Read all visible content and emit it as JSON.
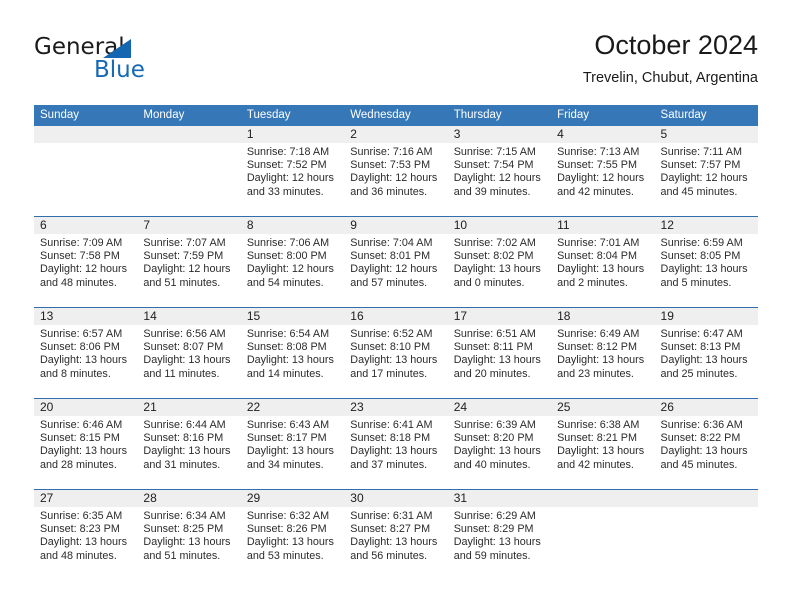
{
  "brand": {
    "name_top": "General",
    "name_bottom": "Blue",
    "triangle_color": "#1566b0",
    "text_color_top": "#1b1b1b",
    "text_color_bottom": "#1669b3"
  },
  "header": {
    "month_title": "October 2024",
    "location": "Trevelin, Chubut, Argentina"
  },
  "theme": {
    "header_bar_color": "#3577b7",
    "header_text_color": "#ffffff",
    "row_divider_color": "#2f6fad",
    "daynum_band_color": "#efefef",
    "body_text_color": "#2b2b2b"
  },
  "calendar": {
    "weekdays": [
      "Sunday",
      "Monday",
      "Tuesday",
      "Wednesday",
      "Thursday",
      "Friday",
      "Saturday"
    ],
    "weeks": [
      [
        {
          "day": "",
          "lines": [
            "",
            "",
            "",
            ""
          ]
        },
        {
          "day": "",
          "lines": [
            "",
            "",
            "",
            ""
          ]
        },
        {
          "day": "1",
          "lines": [
            "Sunrise: 7:18 AM",
            "Sunset: 7:52 PM",
            "Daylight: 12 hours",
            "and 33 minutes."
          ]
        },
        {
          "day": "2",
          "lines": [
            "Sunrise: 7:16 AM",
            "Sunset: 7:53 PM",
            "Daylight: 12 hours",
            "and 36 minutes."
          ]
        },
        {
          "day": "3",
          "lines": [
            "Sunrise: 7:15 AM",
            "Sunset: 7:54 PM",
            "Daylight: 12 hours",
            "and 39 minutes."
          ]
        },
        {
          "day": "4",
          "lines": [
            "Sunrise: 7:13 AM",
            "Sunset: 7:55 PM",
            "Daylight: 12 hours",
            "and 42 minutes."
          ]
        },
        {
          "day": "5",
          "lines": [
            "Sunrise: 7:11 AM",
            "Sunset: 7:57 PM",
            "Daylight: 12 hours",
            "and 45 minutes."
          ]
        }
      ],
      [
        {
          "day": "6",
          "lines": [
            "Sunrise: 7:09 AM",
            "Sunset: 7:58 PM",
            "Daylight: 12 hours",
            "and 48 minutes."
          ]
        },
        {
          "day": "7",
          "lines": [
            "Sunrise: 7:07 AM",
            "Sunset: 7:59 PM",
            "Daylight: 12 hours",
            "and 51 minutes."
          ]
        },
        {
          "day": "8",
          "lines": [
            "Sunrise: 7:06 AM",
            "Sunset: 8:00 PM",
            "Daylight: 12 hours",
            "and 54 minutes."
          ]
        },
        {
          "day": "9",
          "lines": [
            "Sunrise: 7:04 AM",
            "Sunset: 8:01 PM",
            "Daylight: 12 hours",
            "and 57 minutes."
          ]
        },
        {
          "day": "10",
          "lines": [
            "Sunrise: 7:02 AM",
            "Sunset: 8:02 PM",
            "Daylight: 13 hours",
            "and 0 minutes."
          ]
        },
        {
          "day": "11",
          "lines": [
            "Sunrise: 7:01 AM",
            "Sunset: 8:04 PM",
            "Daylight: 13 hours",
            "and 2 minutes."
          ]
        },
        {
          "day": "12",
          "lines": [
            "Sunrise: 6:59 AM",
            "Sunset: 8:05 PM",
            "Daylight: 13 hours",
            "and 5 minutes."
          ]
        }
      ],
      [
        {
          "day": "13",
          "lines": [
            "Sunrise: 6:57 AM",
            "Sunset: 8:06 PM",
            "Daylight: 13 hours",
            "and 8 minutes."
          ]
        },
        {
          "day": "14",
          "lines": [
            "Sunrise: 6:56 AM",
            "Sunset: 8:07 PM",
            "Daylight: 13 hours",
            "and 11 minutes."
          ]
        },
        {
          "day": "15",
          "lines": [
            "Sunrise: 6:54 AM",
            "Sunset: 8:08 PM",
            "Daylight: 13 hours",
            "and 14 minutes."
          ]
        },
        {
          "day": "16",
          "lines": [
            "Sunrise: 6:52 AM",
            "Sunset: 8:10 PM",
            "Daylight: 13 hours",
            "and 17 minutes."
          ]
        },
        {
          "day": "17",
          "lines": [
            "Sunrise: 6:51 AM",
            "Sunset: 8:11 PM",
            "Daylight: 13 hours",
            "and 20 minutes."
          ]
        },
        {
          "day": "18",
          "lines": [
            "Sunrise: 6:49 AM",
            "Sunset: 8:12 PM",
            "Daylight: 13 hours",
            "and 23 minutes."
          ]
        },
        {
          "day": "19",
          "lines": [
            "Sunrise: 6:47 AM",
            "Sunset: 8:13 PM",
            "Daylight: 13 hours",
            "and 25 minutes."
          ]
        }
      ],
      [
        {
          "day": "20",
          "lines": [
            "Sunrise: 6:46 AM",
            "Sunset: 8:15 PM",
            "Daylight: 13 hours",
            "and 28 minutes."
          ]
        },
        {
          "day": "21",
          "lines": [
            "Sunrise: 6:44 AM",
            "Sunset: 8:16 PM",
            "Daylight: 13 hours",
            "and 31 minutes."
          ]
        },
        {
          "day": "22",
          "lines": [
            "Sunrise: 6:43 AM",
            "Sunset: 8:17 PM",
            "Daylight: 13 hours",
            "and 34 minutes."
          ]
        },
        {
          "day": "23",
          "lines": [
            "Sunrise: 6:41 AM",
            "Sunset: 8:18 PM",
            "Daylight: 13 hours",
            "and 37 minutes."
          ]
        },
        {
          "day": "24",
          "lines": [
            "Sunrise: 6:39 AM",
            "Sunset: 8:20 PM",
            "Daylight: 13 hours",
            "and 40 minutes."
          ]
        },
        {
          "day": "25",
          "lines": [
            "Sunrise: 6:38 AM",
            "Sunset: 8:21 PM",
            "Daylight: 13 hours",
            "and 42 minutes."
          ]
        },
        {
          "day": "26",
          "lines": [
            "Sunrise: 6:36 AM",
            "Sunset: 8:22 PM",
            "Daylight: 13 hours",
            "and 45 minutes."
          ]
        }
      ],
      [
        {
          "day": "27",
          "lines": [
            "Sunrise: 6:35 AM",
            "Sunset: 8:23 PM",
            "Daylight: 13 hours",
            "and 48 minutes."
          ]
        },
        {
          "day": "28",
          "lines": [
            "Sunrise: 6:34 AM",
            "Sunset: 8:25 PM",
            "Daylight: 13 hours",
            "and 51 minutes."
          ]
        },
        {
          "day": "29",
          "lines": [
            "Sunrise: 6:32 AM",
            "Sunset: 8:26 PM",
            "Daylight: 13 hours",
            "and 53 minutes."
          ]
        },
        {
          "day": "30",
          "lines": [
            "Sunrise: 6:31 AM",
            "Sunset: 8:27 PM",
            "Daylight: 13 hours",
            "and 56 minutes."
          ]
        },
        {
          "day": "31",
          "lines": [
            "Sunrise: 6:29 AM",
            "Sunset: 8:29 PM",
            "Daylight: 13 hours",
            "and 59 minutes."
          ]
        },
        {
          "day": "",
          "lines": [
            "",
            "",
            "",
            ""
          ]
        },
        {
          "day": "",
          "lines": [
            "",
            "",
            "",
            ""
          ]
        }
      ]
    ]
  }
}
